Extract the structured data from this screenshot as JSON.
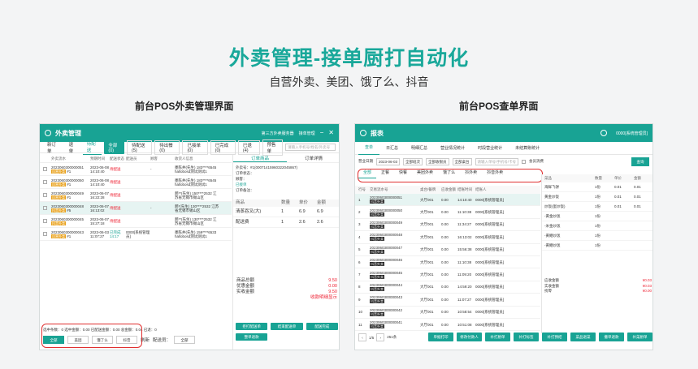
{
  "hero": {
    "title": "外卖管理-接单厨打自动化",
    "subtitle": "自营外卖、美团、饿了么、抖音"
  },
  "sections": {
    "left": "前台POS外卖管理界面",
    "right": "前台POS查单界面"
  },
  "colors": {
    "accent": "#18a394",
    "alert": "#e03030"
  },
  "left_panel": {
    "title": "外卖管理",
    "top_right": [
      "第三方外卖服务器",
      "接单管理"
    ],
    "tabs": [
      "新订单",
      "退单",
      "待配送",
      "全部(0)",
      "待配送(5)",
      "待出餐(0)",
      "已接单(0)",
      "已完成(0)",
      "已退(4)",
      "预售单"
    ],
    "active_tab": 3,
    "search_placeholder": "请输入手机号/姓名/外卖号",
    "columns": [
      "",
      "外卖流水",
      "预期时间",
      "配送状态",
      "配送员",
      "顾客",
      "收货人信息"
    ],
    "orders": [
      {
        "no": "2023060300000051",
        "tag": "自营外卖",
        "idx": "#1",
        "time": "2023-06-08 14:10:40",
        "status": "待配送",
        "rider": "",
        "customer": "-",
        "info": "墨陈井(先生) 183****6545 hallobosd测试测试1"
      },
      {
        "no": "2023060300000050",
        "tag": "自营外卖",
        "idx": "#1",
        "time": "2023-06-08 14:10:40",
        "status": "待配送",
        "rider": "",
        "customer": "",
        "info": "墨陈井(先生) 183****6545 hallobosd测试测试1"
      },
      {
        "no": "2023060300000049",
        "tag": "自营外卖",
        "idx": "#1",
        "time": "2023-06-07 16:22:28",
        "status": "待配送",
        "rider": "",
        "customer": "",
        "info": "郝**(先生) 150****2532 江苏省无锡市锡山区"
      },
      {
        "no": "2023060300000048",
        "tag": "抖音外卖",
        "idx": "#5",
        "time": "2023-06-07 16:13:02",
        "status": "待配送",
        "rider": "",
        "customer": "-",
        "info": "郝*(先生) 130****2532 江苏省无锡市锡山区"
      },
      {
        "no": "2023060300000045",
        "tag": "抖音外卖",
        "idx": "",
        "time": "2023-06-07 15:27:18",
        "status": "待配送",
        "rider": "",
        "customer": "",
        "info": "郝**(先生) 130****2532 江苏省无锡市锡山区"
      },
      {
        "no": "2023060300000043",
        "tag": "自营外卖",
        "idx": "#1",
        "time": "2023-06-03 11:07:27",
        "status": "已完成 14:17",
        "rider": "0000[系统管理员]",
        "customer": "",
        "info": "墨陈井(先生) 159****6533 hallobosd测试测试1"
      }
    ],
    "detail": {
      "tabs": [
        "订单商品",
        "订单详情"
      ],
      "info": [
        "外卖号：#1(00071415960322045867)",
        "订单状态：",
        "顾客：",
        "已接单",
        "订单备注："
      ],
      "items_head": [
        "商品",
        "数量",
        "单价",
        "金额"
      ],
      "items": [
        {
          "name": "清蒸吞叉(大)",
          "qty": "1",
          "price": "6.9",
          "amount": "6.9"
        },
        {
          "name": "配送费",
          "qty": "1",
          "price": "2.6",
          "amount": "2.6"
        }
      ],
      "summary": [
        {
          "label": "商品总额",
          "value": "9.50"
        },
        {
          "label": "优惠金额",
          "value": "0.00"
        },
        {
          "label": "实收金额",
          "value": "9.50"
        },
        {
          "label": "",
          "value": "收款明细显示"
        }
      ],
      "buttons": [
        "拒打配送单",
        "结束配送单",
        "配送完成",
        "整单退款"
      ]
    },
    "stats": "选中条数：0  选中金额：0.00  已配送金额：0.00  总金额：0.04  已退：0",
    "filter_buttons": [
      "全部",
      "美团",
      "饿了么",
      "抖音"
    ],
    "active_filter": 0,
    "refresh_label": "刷新",
    "staff_label": "配送员：",
    "staff_value": "全部"
  },
  "right_panel": {
    "title": "报表",
    "user": "0000[系统管理员]",
    "tabs": [
      "查单",
      "日汇总",
      "明细汇总",
      "营业情况统计",
      "时段营业统计",
      "未结算账统计"
    ],
    "active_tab": 0,
    "filter": {
      "date_label": "营业日期",
      "date": "2023-06-03",
      "shift": "全部班次",
      "terminal": "全部收银员",
      "area": "全部桌台",
      "search": "请输入单号/手机号/卡号",
      "checkbox": "会员消费",
      "query": "查询"
    },
    "sub_tabs": [
      "全部",
      "正餐",
      "快餐",
      "美团外卖",
      "饿了么",
      "抖外卖",
      "抖音外卖"
    ],
    "active_sub": 0,
    "columns": [
      "行号",
      "交易流水号",
      "桌台/餐牌",
      "应收金额",
      "结账时间",
      "结账人"
    ],
    "rows": [
      {
        "n": "1",
        "no": "2023060300000051",
        "tag": "抖音外卖",
        "table": "大厅001",
        "amt": "0.00",
        "time": "14:10:40",
        "user": "0000[系统管理员]"
      },
      {
        "n": "2",
        "no": "2023060300000050",
        "tag": "抖音外卖",
        "table": "大厅001",
        "amt": "0.00",
        "time": "11:10:38",
        "user": "0000[系统管理员]"
      },
      {
        "n": "3",
        "no": "2023060300000049",
        "tag": "抖音外卖",
        "table": "大厅001",
        "amt": "0.00",
        "time": "11:34:27",
        "user": "0000[系统管理员]"
      },
      {
        "n": "4",
        "no": "2023060300000048",
        "tag": "抖音外卖",
        "table": "大厅001",
        "amt": "0.00",
        "time": "16:13:02",
        "user": "0000[系统管理员]"
      },
      {
        "n": "5",
        "no": "2023060300000047",
        "tag": "抖音外卖",
        "table": "大厅001",
        "amt": "0.00",
        "time": "15:56:38",
        "user": "0000[系统管理员]"
      },
      {
        "n": "6",
        "no": "2023060300000046",
        "tag": "抖音外卖",
        "table": "大厅001",
        "amt": "0.00",
        "time": "11:10:38",
        "user": "0000[系统管理员]"
      },
      {
        "n": "7",
        "no": "2023060300000045",
        "tag": "抖音外卖",
        "table": "大厅001",
        "amt": "0.00",
        "time": "11:09:20",
        "user": "0000[系统管理员]"
      },
      {
        "n": "8",
        "no": "2023060300000044",
        "tag": "抖音外卖",
        "table": "大厅001",
        "amt": "0.00",
        "time": "14:59:20",
        "user": "0000[系统管理员]"
      },
      {
        "n": "9",
        "no": "2023060300000043",
        "tag": "抖音外卖",
        "table": "大厅001",
        "amt": "0.00",
        "time": "11:07:27",
        "user": "0000[系统管理员]"
      },
      {
        "n": "10",
        "no": "2023060300000042",
        "tag": "抖音外卖",
        "table": "大厅001",
        "amt": "0.00",
        "time": "10:58:54",
        "user": "0000[系统管理员]"
      },
      {
        "n": "11",
        "no": "2023060300000041",
        "tag": "抖音外卖",
        "table": "大厅001",
        "amt": "0.00",
        "time": "10:51:08",
        "user": "0000[系统管理员]"
      }
    ],
    "side_head": [
      "菜品",
      "数量",
      "单价",
      "金额"
    ],
    "side_items": [
      {
        "name": "海鲜飞饼",
        "qty": "1份",
        "price": "0.01",
        "amt": "0.01"
      },
      {
        "name": "黄金炒饭",
        "qty": "1份",
        "price": "0.01",
        "amt": "0.01"
      },
      {
        "name": "炒饭(蛋炒饭)",
        "qty": "1份",
        "price": "0.01",
        "amt": "0.01"
      },
      {
        "name": "-黄金炒饭",
        "qty": "1份",
        "price": "",
        "amt": ""
      },
      {
        "name": "-米金炒饭",
        "qty": "1份",
        "price": "",
        "amt": ""
      },
      {
        "name": "-黄鳝炒饭",
        "qty": "1份",
        "price": "",
        "amt": ""
      },
      {
        "name": "-黄鳝炒饭",
        "qty": "1份",
        "price": "",
        "amt": ""
      }
    ],
    "side_summary": [
      {
        "label": "应收金额",
        "value": "¥0.03"
      },
      {
        "label": "实收金额",
        "value": "¥0.03"
      },
      {
        "label": "找零",
        "value": "¥0.00"
      }
    ],
    "pager": {
      "page": "1/5",
      "total": "251条"
    },
    "buttons": [
      "单据打印",
      "修改付款人",
      "补打厨单",
      "补打标签",
      "补打预结",
      "菜品退菜",
      "撤单退款",
      "补菜厨单"
    ]
  }
}
